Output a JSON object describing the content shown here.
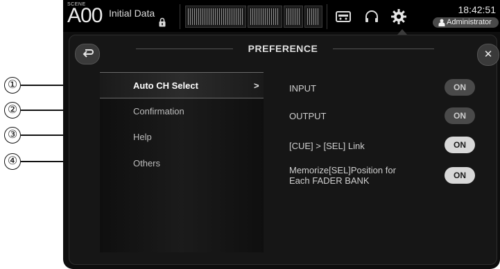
{
  "callouts": [
    "①",
    "②",
    "③",
    "④"
  ],
  "topbar": {
    "scene_label": "SCENE",
    "scene_number": "A00",
    "scene_title": "Initial Data",
    "time": "18:42:51",
    "user": "Administrator"
  },
  "panel": {
    "title": "PREFERENCE",
    "close_symbol": "✕"
  },
  "menu": {
    "items": [
      {
        "label": "Auto CH Select",
        "selected": true
      },
      {
        "label": "Confirmation",
        "selected": false
      },
      {
        "label": "Help",
        "selected": false
      },
      {
        "label": "Others",
        "selected": false
      }
    ],
    "chevron": ">"
  },
  "settings": [
    {
      "label": "INPUT",
      "state": "ON"
    },
    {
      "label": "OUTPUT",
      "state": "ON"
    },
    {
      "label": "[CUE] > [SEL] Link",
      "state": "ON"
    },
    {
      "label_line1": "Memorize[SEL]Position for",
      "label_line2": "Each FADER BANK",
      "state": "ON"
    }
  ],
  "icons": [
    "lock-icon",
    "meter-icon",
    "recorder-icon",
    "headphones-icon",
    "gear-icon",
    "user-icon",
    "back-icon",
    "close-icon"
  ]
}
